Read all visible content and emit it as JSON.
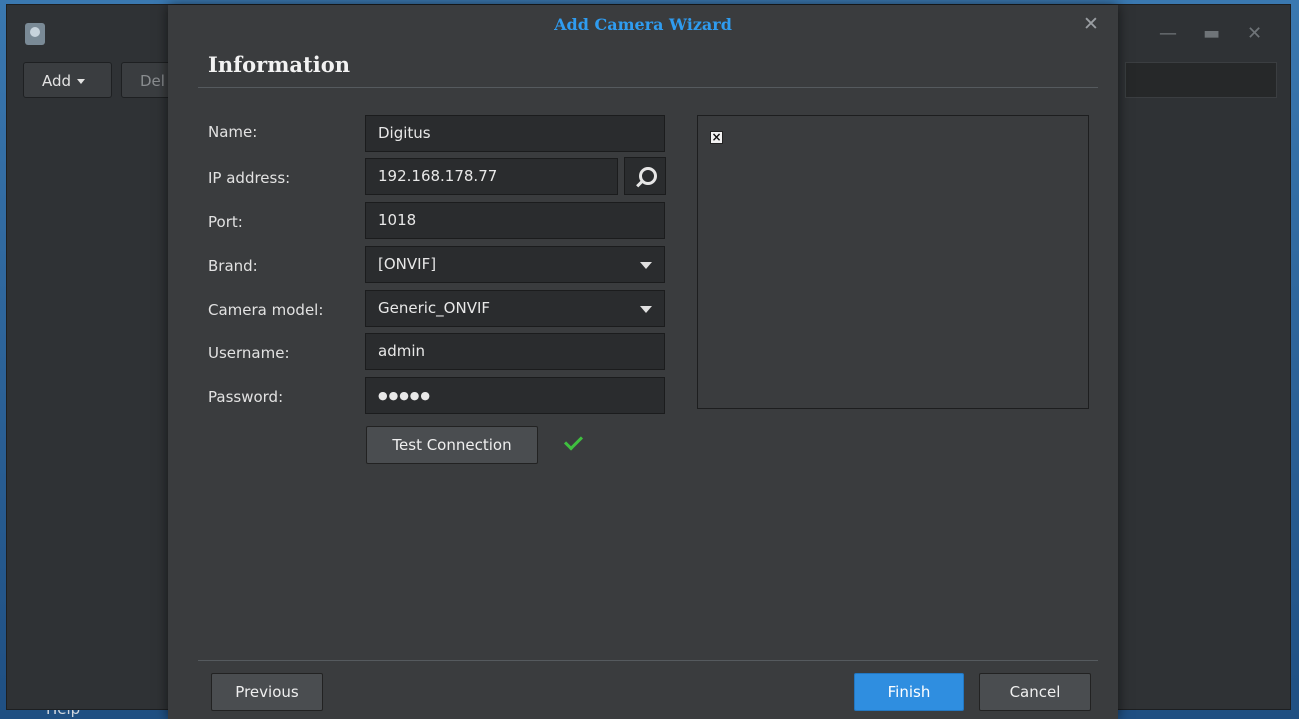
{
  "desktop": {
    "bottom_text": "Help"
  },
  "bg_window": {
    "toolbar": {
      "add_label": "Add",
      "delete_label_partial": "Del"
    }
  },
  "dialog": {
    "title": "Add Camera Wizard",
    "section_title": "Information",
    "fields": {
      "name": {
        "label": "Name:",
        "value": "Digitus"
      },
      "ip": {
        "label": "IP address:",
        "value": "192.168.178.77"
      },
      "port": {
        "label": "Port:",
        "value": "1018"
      },
      "brand": {
        "label": "Brand:",
        "value": "[ONVIF]"
      },
      "model": {
        "label": "Camera model:",
        "value": "Generic_ONVIF"
      },
      "username": {
        "label": "Username:",
        "value": "admin"
      },
      "password": {
        "label": "Password:",
        "value": "●●●●●"
      }
    },
    "test_connection_label": "Test Connection",
    "test_status": "success",
    "buttons": {
      "previous": "Previous",
      "finish": "Finish",
      "cancel": "Cancel"
    }
  },
  "colors": {
    "title_accent": "#2f9cf0",
    "primary_button": "#2f8ee0",
    "success_check": "#3fbf3f"
  }
}
